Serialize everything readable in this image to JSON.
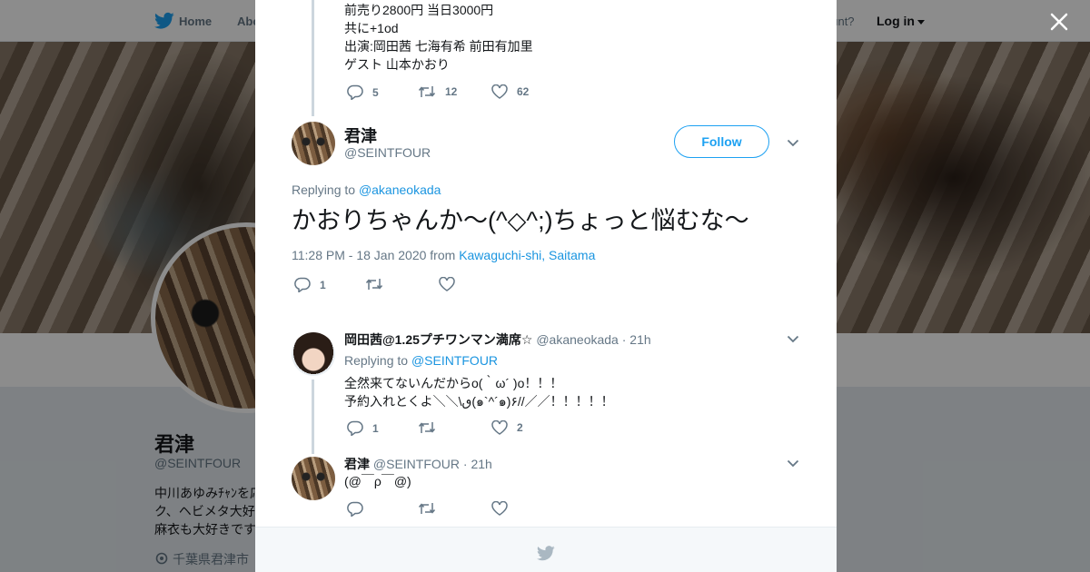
{
  "topnav": {
    "home": "Home",
    "about": "Abo",
    "account_prompt": "ccount?",
    "login": "Log in"
  },
  "profile": {
    "name": "君津",
    "handle": "@SEINTFOUR",
    "bio_lines": [
      "中川あゆみﾁｬﾝを応",
      "ク、ヘビメタ大好き",
      "麻衣も大好きです"
    ],
    "location": "千葉県君津市"
  },
  "thread_parent": {
    "lines": [
      "前売り2800円 当日3000円",
      "共に+1od",
      "出演:岡田茜 七海有希 前田有加里",
      "ゲスト 山本かおり"
    ],
    "replies": "5",
    "retweets": "12",
    "likes": "62"
  },
  "main_tweet": {
    "name": "君津",
    "handle": "@SEINTFOUR",
    "follow_label": "Follow",
    "replying_prefix": "Replying to",
    "replying_to": "@akaneokada",
    "text": "かおりちゃんか〜(^◇^;)ちょっと悩むな〜",
    "timestamp": "11:28 PM - 18 Jan 2020 from",
    "place": "Kawaguchi-shi, Saitama",
    "replies": "1",
    "retweets": "",
    "likes": ""
  },
  "reply1": {
    "name": "岡田茜@1.25プチワンマン満席☆",
    "handle": "@akaneokada",
    "time": "· 21h",
    "replying_prefix": "Replying to",
    "replying_to": "@SEINTFOUR",
    "lines": [
      "全然来てないんだからo(｀ω´ )o！！！",
      "予約入れとくよ＼＼\\ٯ(๑`^´๑)۶//／／！！！！！"
    ],
    "replies": "1",
    "retweets": "",
    "likes": "2"
  },
  "reply2": {
    "name": "君津",
    "handle": "@SEINTFOUR",
    "time": "· 21h",
    "text": "(@￣ρ￣@)",
    "replies": "",
    "retweets": "",
    "likes": ""
  },
  "colors": {
    "twitter_blue": "#1da1f2",
    "link_blue": "#1b95e0",
    "muted": "#657786"
  },
  "icons": [
    "twitter-bird-icon",
    "close-icon",
    "reply-icon",
    "retweet-icon",
    "like-icon",
    "chevron-down-icon",
    "location-pin-icon"
  ]
}
